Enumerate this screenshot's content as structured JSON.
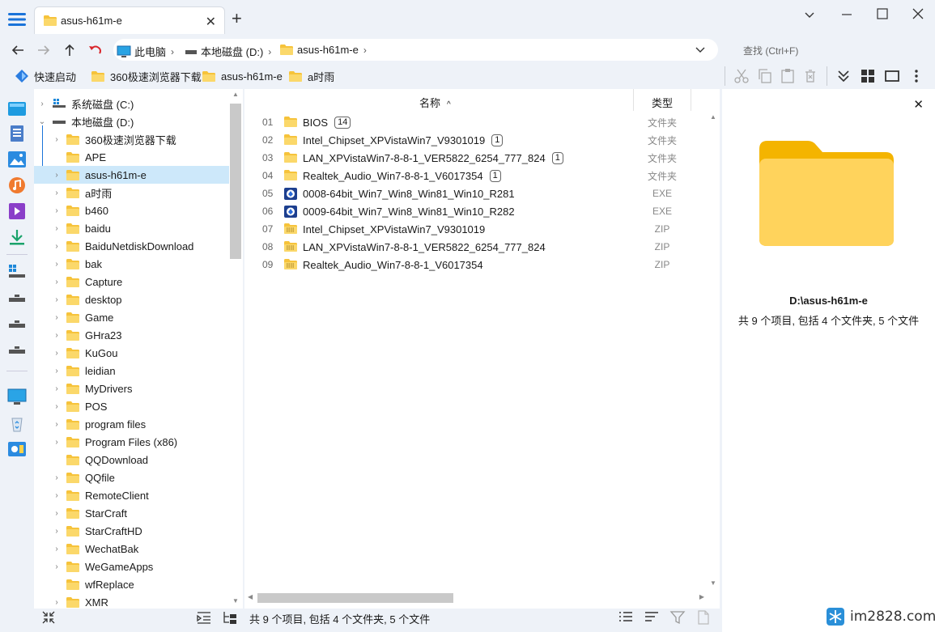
{
  "tab": {
    "title": "asus-h61m-e"
  },
  "breadcrumb": [
    "此电脑",
    "本地磁盘 (D:)",
    "asus-h61m-e"
  ],
  "search": {
    "placeholder": "查找 (Ctrl+F)"
  },
  "quickbar": [
    "快速启动",
    "360极速浏览器下载",
    "asus-h61m-e",
    "a时雨"
  ],
  "tree": {
    "drives": [
      "系统磁盘 (C:)",
      "本地磁盘 (D:)"
    ],
    "folders": [
      "360极速浏览器下载",
      "APE",
      "asus-h61m-e",
      "a时雨",
      "b460",
      "baidu",
      "BaiduNetdiskDownload",
      "bak",
      "Capture",
      "desktop",
      "Game",
      "GHra23",
      "KuGou",
      "leidian",
      "MyDrivers",
      "POS",
      "program files",
      "Program Files (x86)",
      "QQDownload",
      "QQfile",
      "RemoteClient",
      "StarCraft",
      "StarCraftHD",
      "WechatBak",
      "WeGameApps",
      "wfReplace",
      "XMR"
    ]
  },
  "columns": {
    "name": "名称",
    "type": "类型"
  },
  "files": [
    {
      "num": "01",
      "name": "BIOS",
      "badge": "14",
      "type": "文件夹",
      "kind": "folder"
    },
    {
      "num": "02",
      "name": "Intel_Chipset_XPVistaWin7_V9301019",
      "badge": "1",
      "type": "文件夹",
      "kind": "folder"
    },
    {
      "num": "03",
      "name": "LAN_XPVistaWin7-8-8-1_VER5822_6254_777_824",
      "badge": "1",
      "type": "文件夹",
      "kind": "folder"
    },
    {
      "num": "04",
      "name": "Realtek_Audio_Win7-8-8-1_V6017354",
      "badge": "1",
      "type": "文件夹",
      "kind": "folder"
    },
    {
      "num": "05",
      "name": "0008-64bit_Win7_Win8_Win81_Win10_R281",
      "badge": "",
      "type": "EXE",
      "kind": "exe"
    },
    {
      "num": "06",
      "name": "0009-64bit_Win7_Win8_Win81_Win10_R282",
      "badge": "",
      "type": "EXE",
      "kind": "exe"
    },
    {
      "num": "07",
      "name": "Intel_Chipset_XPVistaWin7_V9301019",
      "badge": "",
      "type": "ZIP",
      "kind": "zip"
    },
    {
      "num": "08",
      "name": "LAN_XPVistaWin7-8-8-1_VER5822_6254_777_824",
      "badge": "",
      "type": "ZIP",
      "kind": "zip"
    },
    {
      "num": "09",
      "name": "Realtek_Audio_Win7-8-8-1_V6017354",
      "badge": "",
      "type": "ZIP",
      "kind": "zip"
    }
  ],
  "preview": {
    "path": "D:\\asus-h61m-e",
    "info": "共 9 个项目, 包括 4 个文件夹, 5 个文件"
  },
  "status": {
    "text": "共 9 个项目, 包括 4 个文件夹, 5 个文件"
  },
  "watermark": "im2828.com",
  "colors": {
    "accent": "#1a73d9",
    "selection": "#cde8fa",
    "folder": "#f6c33b"
  }
}
